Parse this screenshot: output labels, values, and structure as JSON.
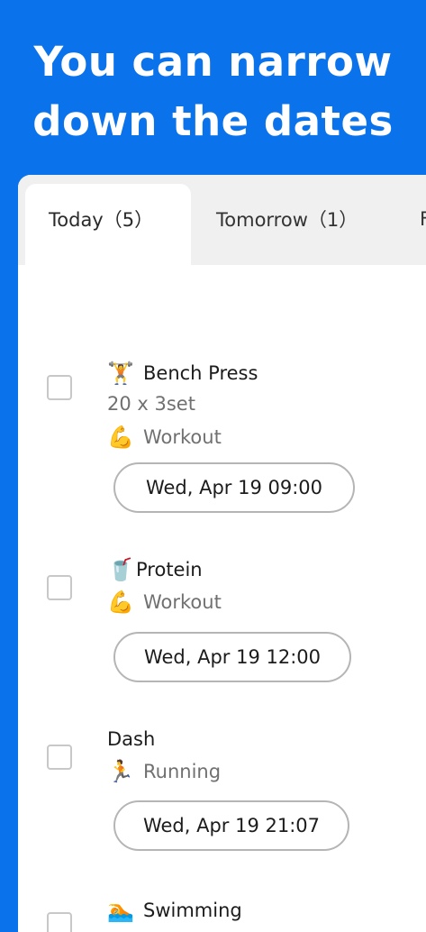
{
  "headline": {
    "line1": "You can narrow",
    "line2": "down the dates"
  },
  "tabs": [
    {
      "label": "Today（5）",
      "active": true
    },
    {
      "label": "Tomorrow（1）",
      "active": false
    },
    {
      "label": "F",
      "active": false
    }
  ],
  "tasks": [
    {
      "emoji": "🏋️",
      "title": "Bench Press",
      "detail": "20 x 3set",
      "category_emoji": "💪",
      "category": "Workout",
      "date": "Wed, Apr 19 09:00",
      "checked": false
    },
    {
      "emoji": "🥤",
      "title": "Protein",
      "category_emoji": "💪",
      "category": "Workout",
      "date": "Wed, Apr 19 12:00",
      "checked": false
    },
    {
      "title": "Dash",
      "category_emoji": "🏃",
      "category": "Running",
      "date": "Wed, Apr 19 21:07",
      "checked": false
    },
    {
      "emoji": "🏊",
      "title": "Swimming",
      "checked": false
    }
  ],
  "colors": {
    "background": "#0a73ec",
    "card": "#ffffff",
    "tab_bar": "#f0f0f0",
    "text": "#1c1c1c",
    "subtext": "#707070",
    "pill_border": "#b5b5b5"
  }
}
